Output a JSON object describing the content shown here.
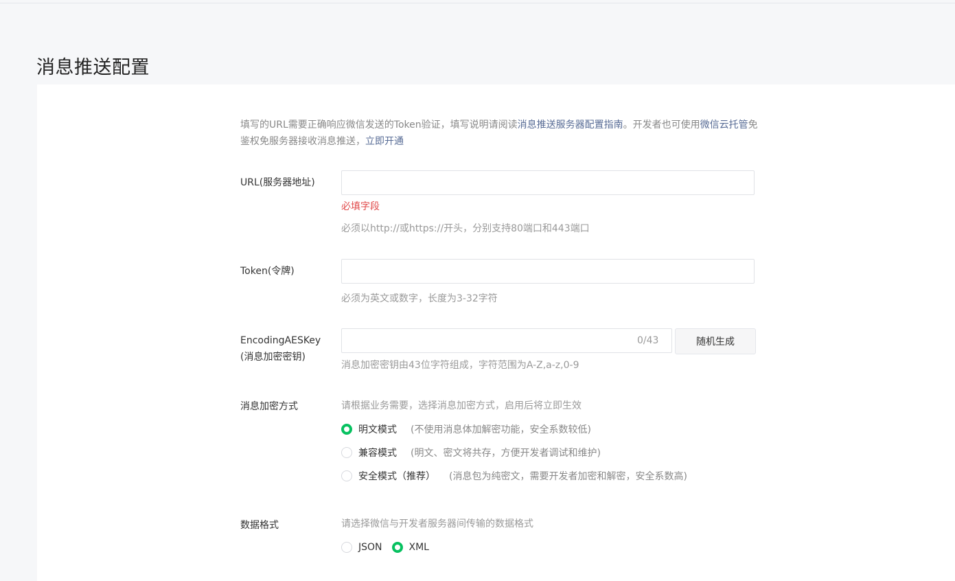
{
  "page": {
    "title": "消息推送配置"
  },
  "intro": {
    "text1": "填写的URL需要正确响应微信发送的Token验证，填写说明请阅读",
    "link_guide": "消息推送服务器配置指南",
    "text2": "。开发者也可使用",
    "link_cloud": "微信云托管",
    "text3": "免鉴权免服务器接收消息推送，",
    "link_open": "立即开通"
  },
  "url_field": {
    "label": "URL(服务器地址)",
    "value": "",
    "error": "必填字段",
    "hint": "必须以http://或https://开头，分别支持80端口和443端口"
  },
  "token_field": {
    "label": "Token(令牌)",
    "value": "",
    "hint": "必须为英文或数字，长度为3-32字符"
  },
  "aes_field": {
    "label_line1": "EncodingAESKey",
    "label_line2": "(消息加密密钥)",
    "value": "",
    "counter": "0/43",
    "generate_button": "随机生成",
    "hint": "消息加密密钥由43位字符组成，字符范围为A-Z,a-z,0-9"
  },
  "encryption": {
    "label": "消息加密方式",
    "hint": "请根据业务需要，选择消息加密方式，启用后将立即生效",
    "options": [
      {
        "label": "明文模式",
        "desc": "(不使用消息体加解密功能，安全系数较低)",
        "selected": true
      },
      {
        "label": "兼容模式",
        "desc": "(明文、密文将共存，方便开发者调试和维护)",
        "selected": false
      },
      {
        "label": "安全模式（推荐）",
        "desc": "(消息包为纯密文，需要开发者加密和解密，安全系数高)",
        "selected": false
      }
    ]
  },
  "data_format": {
    "label": "数据格式",
    "hint": "请选择微信与开发者服务器间传输的数据格式",
    "options": [
      {
        "label": "JSON",
        "selected": false
      },
      {
        "label": "XML",
        "selected": true
      }
    ]
  },
  "colors": {
    "accent": "#07c160",
    "link": "#576b95",
    "error": "#e04a4a"
  }
}
